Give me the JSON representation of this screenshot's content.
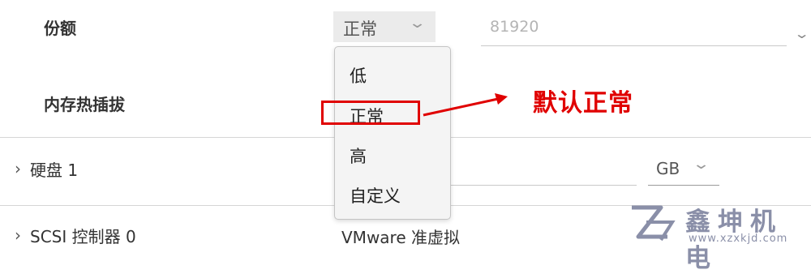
{
  "rows": {
    "shares": {
      "label": "份额",
      "level_value": "正常",
      "share_value": "81920"
    },
    "memory_hot_plug": {
      "label": "内存热插拔"
    },
    "hard_disk": {
      "label": "硬盘 1",
      "unit": "GB"
    },
    "scsi": {
      "label": "SCSI 控制器 0",
      "value": "VMware 准虚拟"
    }
  },
  "dropdown": {
    "options": [
      "低",
      "正常",
      "高",
      "自定义"
    ],
    "highlighted": "正常"
  },
  "annotation": {
    "text": "默认正常",
    "color": "#e00000"
  },
  "watermark": {
    "text": "鑫坤机电",
    "url": "www.xzxkjd.com"
  },
  "icons": {
    "chevron_down": "chevron-down-icon",
    "chevron_right": "chevron-right-icon",
    "arrow": "red-arrow-icon"
  }
}
